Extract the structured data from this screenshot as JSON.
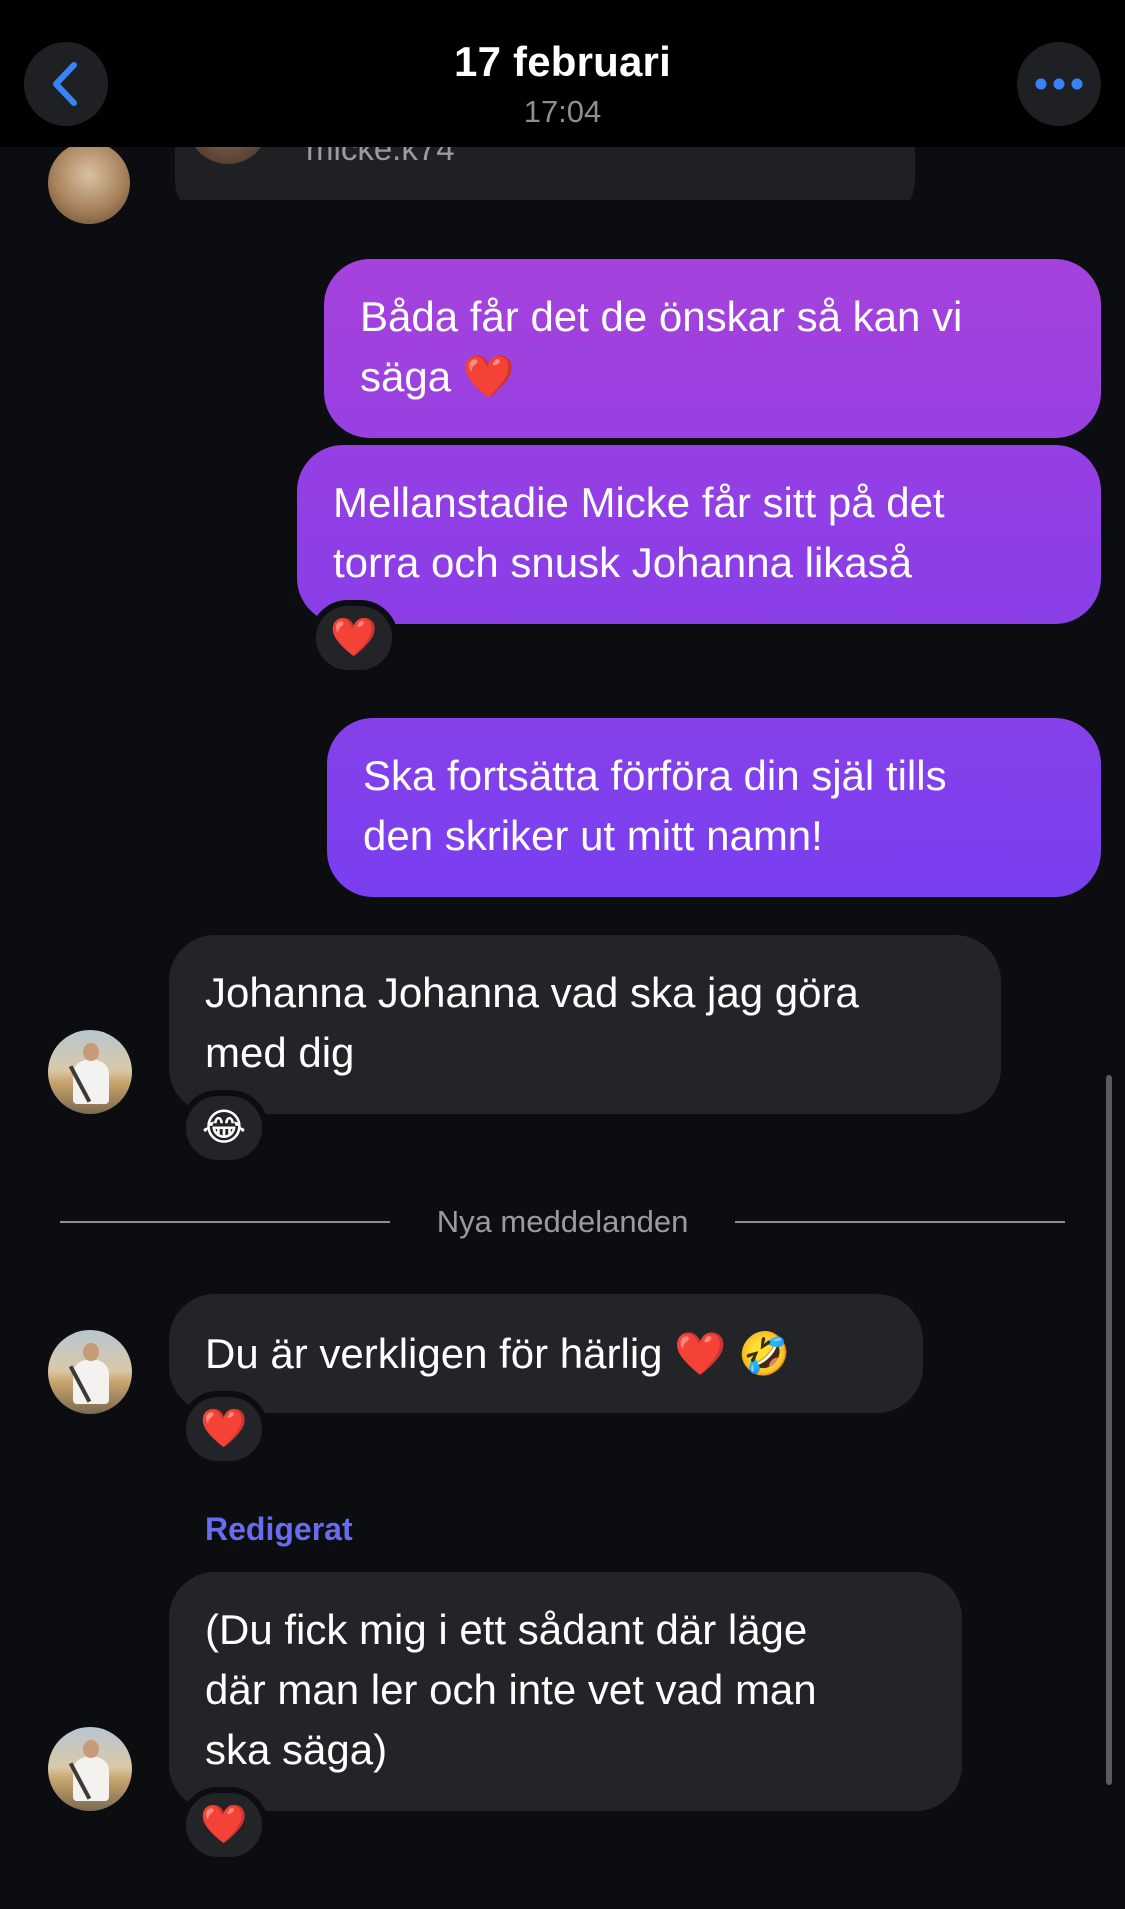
{
  "header": {
    "title": "17 februari",
    "time": "17:04",
    "back_icon": "chevron-left-icon",
    "more_icon": "ellipsis-icon",
    "accent_color": "#3a82f7"
  },
  "previous_message": {
    "username": "micke.k74"
  },
  "messages": [
    {
      "direction": "sent",
      "text": "Båda får det de önskar så kan vi\nsäga ❤️"
    },
    {
      "direction": "sent",
      "text": "Mellanstadie Micke får sitt på det\ntorra och snusk Johanna likaså",
      "reaction": "❤️"
    },
    {
      "direction": "sent",
      "text": "Ska fortsätta förföra din själ tills\nden skriker ut mitt namn!"
    },
    {
      "direction": "received",
      "text": "Johanna Johanna vad ska jag göra\nmed dig",
      "reaction": "😂"
    },
    {
      "direction": "received",
      "text": "Du är verkligen för härlig ❤️ 🤣",
      "reaction": "❤️"
    },
    {
      "direction": "received",
      "text": "(Du fick mig i ett sådant där läge\ndär man ler och inte vet vad man\nska säga)",
      "reaction": "❤️",
      "edited_label": "Redigerat"
    }
  ],
  "new_messages_separator": "Nya meddelanden",
  "colors": {
    "sent_gradient_top": "#a541dc",
    "sent_gradient_bottom": "#7a3ff0",
    "received_bubble": "#232428",
    "background": "#0c0d11",
    "edited_label": "#6a6cf0"
  }
}
